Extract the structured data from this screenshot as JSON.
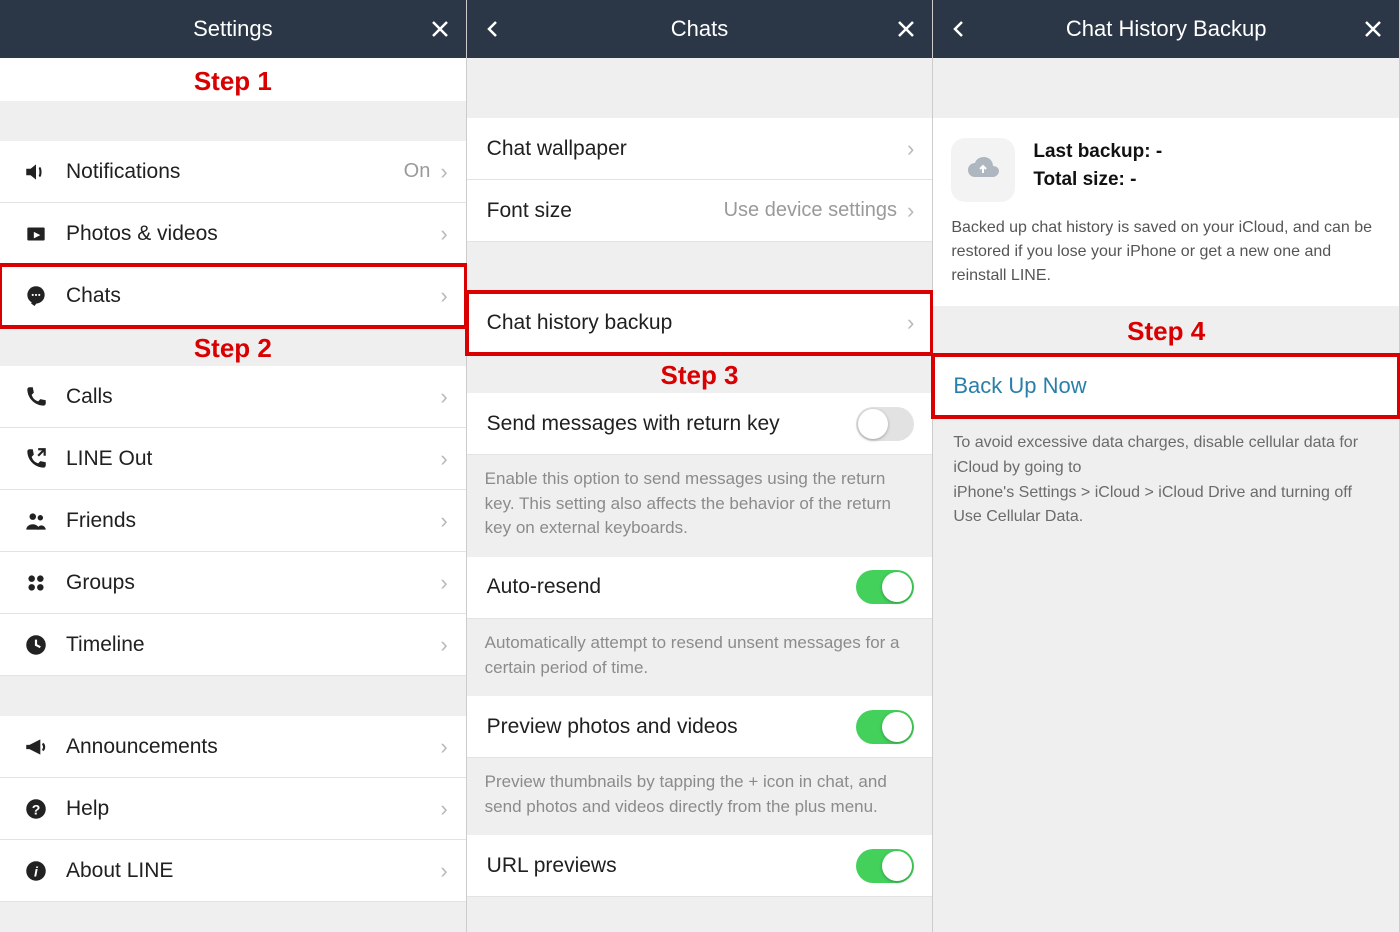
{
  "panel1": {
    "title": "Settings",
    "step": "Step 1",
    "step2": "Step 2",
    "rows": {
      "notifications": {
        "label": "Notifications",
        "value": "On"
      },
      "photos": {
        "label": "Photos & videos"
      },
      "chats": {
        "label": "Chats"
      },
      "calls": {
        "label": "Calls"
      },
      "lineout": {
        "label": "LINE Out"
      },
      "friends": {
        "label": "Friends"
      },
      "groups": {
        "label": "Groups"
      },
      "timeline": {
        "label": "Timeline"
      },
      "announcements": {
        "label": "Announcements"
      },
      "help": {
        "label": "Help"
      },
      "about": {
        "label": "About LINE"
      }
    }
  },
  "panel2": {
    "title": "Chats",
    "step": "Step 3",
    "rows": {
      "wallpaper": {
        "label": "Chat wallpaper"
      },
      "fontsize": {
        "label": "Font size",
        "value": "Use device settings"
      },
      "history": {
        "label": "Chat history backup"
      },
      "returnkey": {
        "label": "Send messages with return key",
        "toggle": "off",
        "desc": "Enable this option to send messages using the return key. This setting also affects the behavior of the return key on external keyboards."
      },
      "autoresend": {
        "label": "Auto-resend",
        "toggle": "on",
        "desc": "Automatically attempt to resend unsent messages for a certain period of time."
      },
      "preview": {
        "label": "Preview photos and videos",
        "toggle": "on",
        "desc": "Preview thumbnails by tapping the + icon in chat, and send photos and videos directly from the plus menu."
      },
      "urlprev": {
        "label": "URL previews",
        "toggle": "on"
      }
    }
  },
  "panel3": {
    "title": "Chat History Backup",
    "lastBackup": "Last backup: -",
    "totalSize": "Total size: -",
    "note": "Backed up chat history is saved on your iCloud, and can be restored if you lose your iPhone or get a new one and reinstall LINE.",
    "step": "Step 4",
    "backupNow": "Back Up Now",
    "warning": "To avoid excessive data charges, disable cellular data for iCloud by going to\niPhone's Settings > iCloud > iCloud Drive and turning off Use Cellular Data."
  }
}
